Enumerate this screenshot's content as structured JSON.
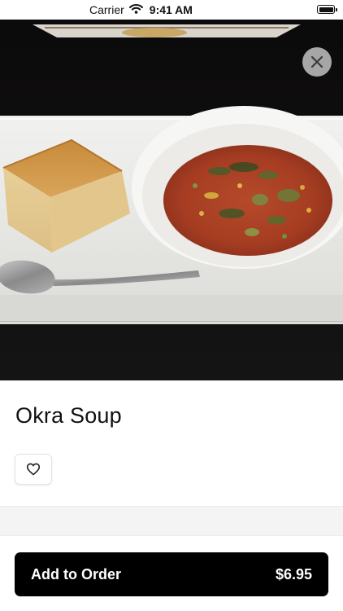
{
  "status_bar": {
    "carrier": "Carrier",
    "time": "9:41 AM"
  },
  "item": {
    "name": "Okra Soup",
    "image_subject": "bowl of okra soup with cornbread and a spoon on a white plate"
  },
  "order_button": {
    "label": "Add to Order",
    "price": "$6.95"
  },
  "icons": {
    "close": "close-icon",
    "favorite": "heart-outline-icon",
    "wifi": "wifi-icon",
    "battery": "battery-icon"
  },
  "colors": {
    "order_button_bg": "#000000",
    "order_button_text": "#ffffff",
    "photo_background": "#0c0b0b",
    "divider": "#f4f4f4"
  }
}
